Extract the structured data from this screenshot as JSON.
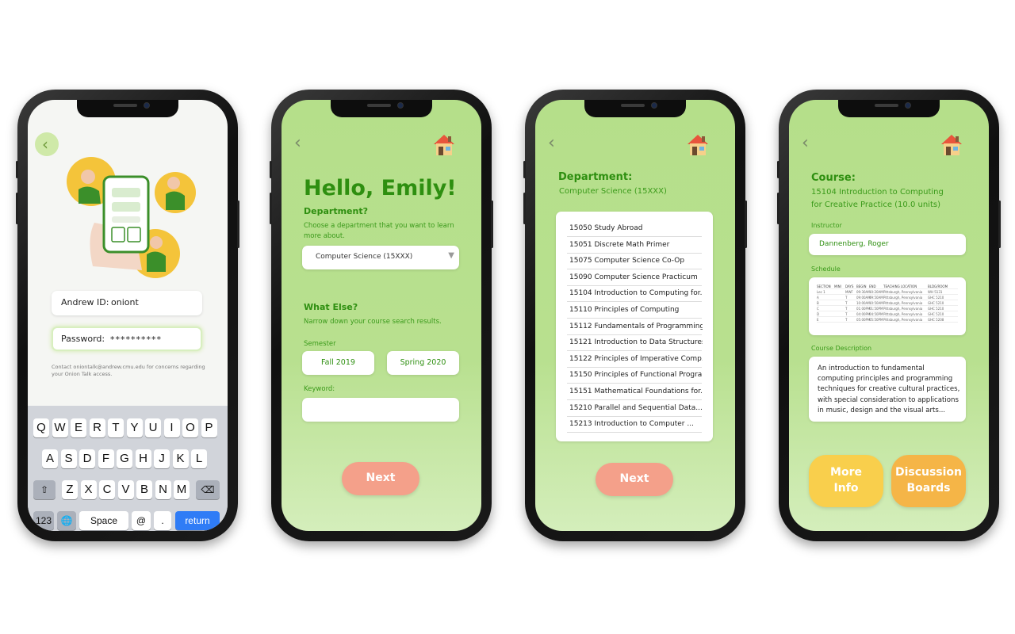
{
  "colors": {
    "accent_green": "#2e8f10",
    "next_button": "#f4a08a",
    "yellow_button": "#f9cf4c",
    "orange_button": "#f5b547",
    "return_key": "#2f7cf6"
  },
  "login": {
    "andrew_label": "Andrew ID:",
    "andrew_value": "oniont",
    "password_label": "Password:",
    "password_value": "**********",
    "contact": "Contact oniontalk@andrew.cmu.edu for concerns regarding your Onion Talk access."
  },
  "keyboard": {
    "row1": [
      "Q",
      "W",
      "E",
      "R",
      "T",
      "Y",
      "U",
      "I",
      "O",
      "P"
    ],
    "row2": [
      "A",
      "S",
      "D",
      "F",
      "G",
      "H",
      "J",
      "K",
      "L"
    ],
    "row3": [
      "Z",
      "X",
      "C",
      "V",
      "B",
      "N",
      "M"
    ],
    "num": "123",
    "space": "Space",
    "at": "@",
    "dot": ".",
    "return": "return"
  },
  "search": {
    "greeting": "Hello, Emily!",
    "department_label": "Department?",
    "department_hint": "Choose a department that you want to learn more about.",
    "department_value": "Computer Science (15XXX)",
    "what_else": "What Else?",
    "what_else_hint": "Narrow down your course search results.",
    "semester_label": "Semester",
    "semester_options": [
      "Fall 2019",
      "Spring 2020"
    ],
    "keyword_label": "Keyword:",
    "keyword_value": "",
    "next": "Next"
  },
  "course_list": {
    "title": "Department:",
    "department": "Computer Science (15XXX)",
    "courses": [
      "15050 Study Abroad",
      "15051 Discrete Math Primer",
      "15075 Computer Science Co-Op",
      "15090 Computer Science Practicum",
      "15104 Introduction to Computing for...",
      "15110 Principles of Computing",
      "15112 Fundamentals of Programming...",
      "15121 Introduction to Data Structures",
      "15122 Principles of Imperative Comp...",
      "15150 Principles of Functional Progra...",
      "15151 Mathematical Foundations for...",
      "15210 Parallel and Sequential Data...",
      "15213 Introduction to Computer ..."
    ],
    "next": "Next"
  },
  "course_detail": {
    "title": "Course:",
    "course_line1": "15104 Introduction to Computing",
    "course_line2": "for Creative Practice (10.0 units)",
    "instructor_label": "Instructor",
    "instructor": "Dannenberg, Roger",
    "schedule_label": "Schedule",
    "schedule_headers": [
      "SECTION",
      "MINI",
      "DAYS",
      "BEGIN",
      "END",
      "TEACHING LOCATION",
      "BLDG/ROOM"
    ],
    "schedule_rows": [
      [
        "Lec 1",
        "",
        "MWF",
        "09:30AM",
        "10:20AM",
        "Pittsburgh, Pennsylvania",
        "WH 5131"
      ],
      [
        "A",
        "",
        "T",
        "09:00AM",
        "09:50AM",
        "Pittsburgh, Pennsylvania",
        "GHC 5210"
      ],
      [
        "B",
        "",
        "T",
        "10:00AM",
        "10:50AM",
        "Pittsburgh, Pennsylvania",
        "GHC 5210"
      ],
      [
        "C",
        "",
        "T",
        "01:00PM",
        "01:50PM",
        "Pittsburgh, Pennsylvania",
        "GHC 5210"
      ],
      [
        "D",
        "",
        "T",
        "04:00PM",
        "04:50PM",
        "Pittsburgh, Pennsylvania",
        "GHC 5210"
      ],
      [
        "E",
        "",
        "T",
        "05:00PM",
        "05:50PM",
        "Pittsburgh, Pennsylvania",
        "GHC 5208"
      ]
    ],
    "description_label": "Course Description",
    "description": [
      "An introduction to fundamental",
      "computing principles and programming",
      "techniques for creative cultural practices,",
      "with special consideration to applications",
      "in music, design and the visual arts..."
    ],
    "more_info": [
      "More",
      "Info"
    ],
    "discussion": [
      "Discussion",
      "Boards"
    ]
  }
}
